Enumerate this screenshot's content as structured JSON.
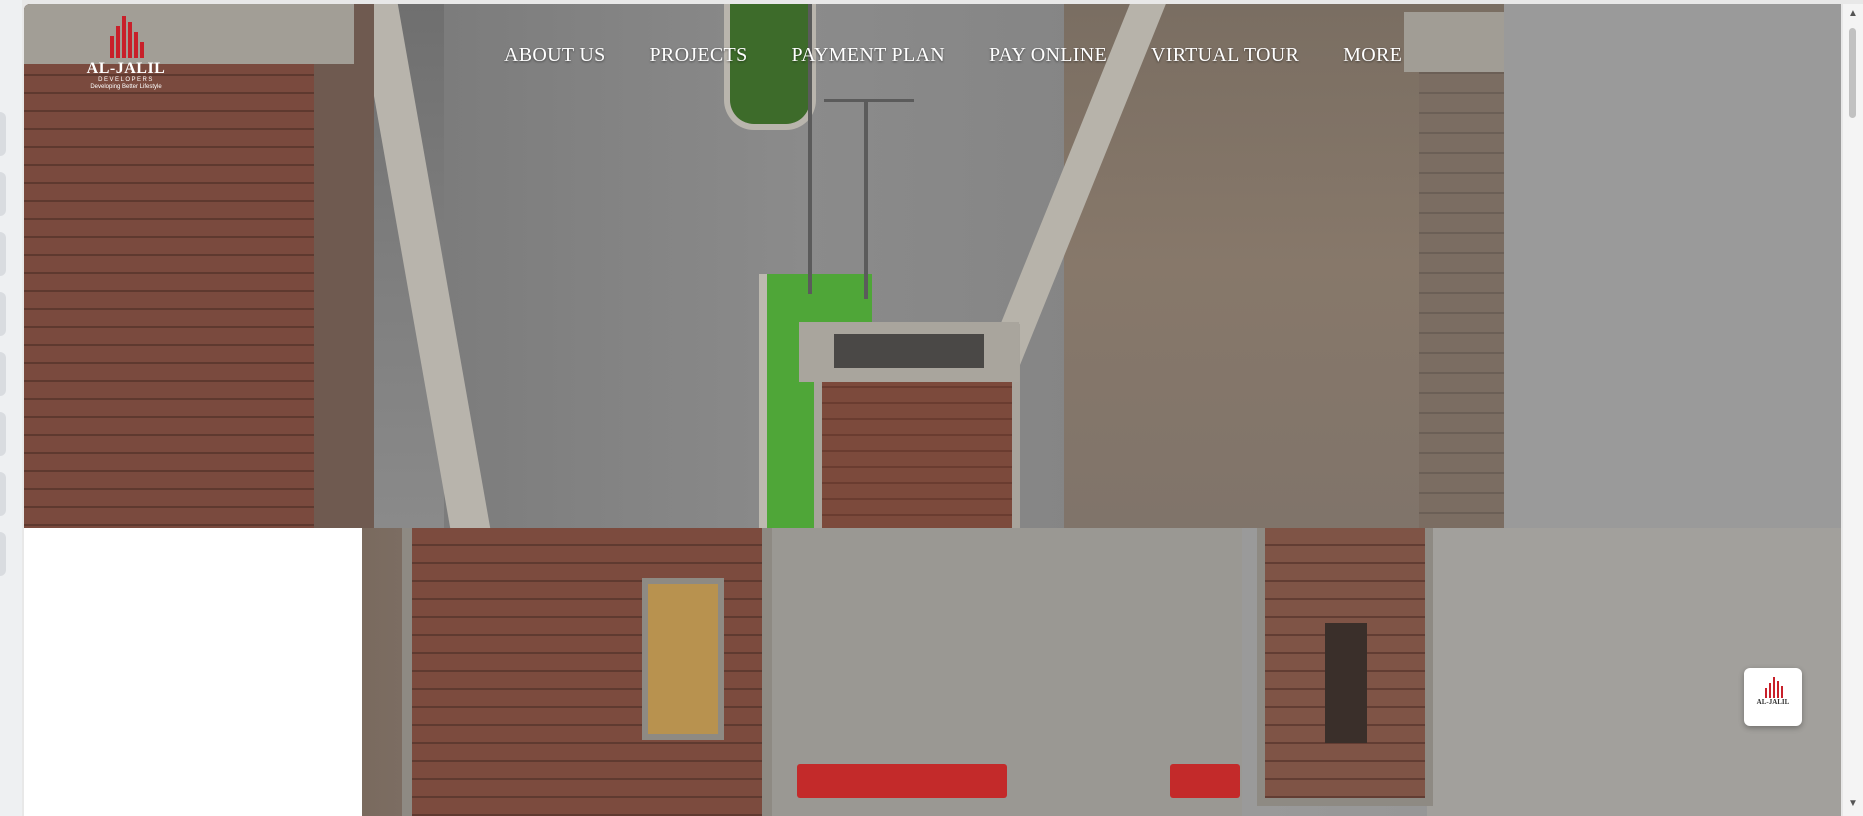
{
  "brand": {
    "name": "AL-JALIL",
    "sub": "DEVELOPERS",
    "tagline": "Developing Better Lifestyle",
    "accent_color": "#c8202a"
  },
  "nav": {
    "items": [
      {
        "label": "ABOUT US"
      },
      {
        "label": "PROJECTS"
      },
      {
        "label": "PAYMENT PLAN"
      },
      {
        "label": "PAY ONLINE"
      },
      {
        "label": "VIRTUAL TOUR"
      },
      {
        "label": "MORE"
      }
    ]
  },
  "widget": {
    "name": "AL-JALIL"
  },
  "scrollbar": {
    "up_icon": "chevron-up-icon",
    "down_icon": "chevron-down-icon"
  }
}
